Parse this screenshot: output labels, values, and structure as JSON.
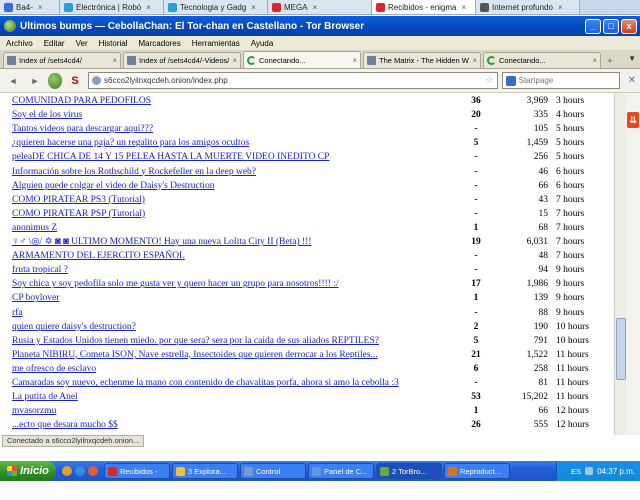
{
  "host_tabs": [
    {
      "label": "Ba4-",
      "color": "#3b6bd6",
      "active": false
    },
    {
      "label": "Electrónica | Robó",
      "color": "#2a9dd6",
      "active": false
    },
    {
      "label": "Tecnologia y Gadg",
      "color": "#2a9dd6",
      "active": false
    },
    {
      "label": "MEGA",
      "color": "#d9272e",
      "active": false
    },
    {
      "label": "Recibidos - enigma",
      "color": "#d9272e",
      "active": true
    },
    {
      "label": "Internet profundo",
      "color": "#555555",
      "active": false
    }
  ],
  "window": {
    "title": "Últimos bumps — CebollaChan: El Tor-chan en Castellano - Tor Browser",
    "minimize": "_",
    "maximize": "□",
    "close": "x"
  },
  "menu": [
    "Archivo",
    "Editar",
    "Ver",
    "Historial",
    "Marcadores",
    "Herramientas",
    "Ayuda"
  ],
  "tabs": [
    {
      "label": "Index of /sets4cd4/",
      "active": false,
      "loading": false
    },
    {
      "label": "Index of /sets4cd4/-Videos/",
      "active": false,
      "loading": false
    },
    {
      "label": "Conectando...",
      "active": true,
      "loading": true
    },
    {
      "label": "The Matrix - The Hidden Wiki",
      "active": false,
      "loading": false
    },
    {
      "label": "Conectando...",
      "active": false,
      "loading": true
    }
  ],
  "nav": {
    "back": "◄",
    "forward": "►",
    "url": "s6cco2lyilnxqcdeh.onion/index.php",
    "search_placeholder": "Startpage"
  },
  "threads": [
    {
      "topic": "COMUNIDAD PARA PEDOFILOS",
      "replies": "36",
      "views": "3,969",
      "age": "3 hours"
    },
    {
      "topic": "Soy el de los virus",
      "replies": "20",
      "views": "335",
      "age": "4 hours"
    },
    {
      "topic": "Tantos videos para descargar aqui???",
      "replies": "-",
      "views": "105",
      "age": "5 hours"
    },
    {
      "topic": "¿quieren hacerse una paja? un regalito para los amigos ocultos",
      "replies": "5",
      "views": "1,459",
      "age": "5 hours"
    },
    {
      "topic": "peleaDE CHICA DE 14 Y 15 PELEA HASTA LA MUERTE VIDEO INEDITO CP",
      "replies": "-",
      "views": "256",
      "age": "5 hours"
    },
    {
      "topic": "Información sobre los Rothschild y Rockefeller en la deep web?",
      "replies": "-",
      "views": "46",
      "age": "6 hours"
    },
    {
      "topic": "Alguien puede colgar el video de Daisy's Destruction",
      "replies": "-",
      "views": "66",
      "age": "6 hours"
    },
    {
      "topic": "COMO PIRATEAR PS3 (Tutorial)",
      "replies": "-",
      "views": "43",
      "age": "7 hours"
    },
    {
      "topic": "COMO PIRATEAR PSP (Tutorial)",
      "replies": "-",
      "views": "15",
      "age": "7 hours"
    },
    {
      "topic": "anonimus Z",
      "replies": "1",
      "views": "68",
      "age": "7 hours"
    },
    {
      "topic": "♀♂ \\◎/ ✡ ◙ ◙ ULTIMO MOMENTO! Hay una nueva Lolita City II (Beta) !!!",
      "replies": "19",
      "views": "6,031",
      "age": "7 hours"
    },
    {
      "topic": "ARMAMENTO DEL EJERCITO ESPAÑOL",
      "replies": "-",
      "views": "48",
      "age": "7 hours"
    },
    {
      "topic": "fruta tropical ?",
      "replies": "-",
      "views": "94",
      "age": "9 hours"
    },
    {
      "topic": "Soy chica y soy pedofila solo me gusta ver y quero hacer un grupo para nosotros!!!! :/",
      "replies": "17",
      "views": "1,986",
      "age": "9 hours"
    },
    {
      "topic": "CP boylover",
      "replies": "1",
      "views": "139",
      "age": "9 hours"
    },
    {
      "topic": "rfa",
      "replies": "-",
      "views": "88",
      "age": "9 hours"
    },
    {
      "topic": "quien quiere daisy's destruction?",
      "replies": "2",
      "views": "190",
      "age": "10 hours"
    },
    {
      "topic": "Rusia y Estados Unidos tienen miedo. por que sera? sera por la caida de sus aliados REPTILES?",
      "replies": "5",
      "views": "791",
      "age": "10 hours"
    },
    {
      "topic": "Planeta NIBIRU, Cometa ISON, Nave estrella, Insectoides que quieren derrocar a los Reptiles...",
      "replies": "21",
      "views": "1,522",
      "age": "11 hours"
    },
    {
      "topic": "me ofresco de esclavo",
      "replies": "6",
      "views": "258",
      "age": "11 hours"
    },
    {
      "topic": "Camaradas soy nuevo, echenme la mano con contenido de chavalitas porfa, ahora si amo la cebolla :3",
      "replies": "-",
      "views": "81",
      "age": "11 hours"
    },
    {
      "topic": "La putita de Anel",
      "replies": "53",
      "views": "15,202",
      "age": "11 hours"
    },
    {
      "topic": "mvasorzmu",
      "replies": "1",
      "views": "66",
      "age": "12 hours"
    },
    {
      "topic": "...ecto que desara mucho $$",
      "replies": "26",
      "views": "555",
      "age": "12 hours"
    }
  ],
  "status": "Conectado a s6cco2lyilnxqcdeh.onion...",
  "taskbar": {
    "start": "Inicio",
    "tasks": [
      {
        "label": "Recibidos -",
        "color": "#d9272e",
        "active": false
      },
      {
        "label": "3 Explora...",
        "color": "#f0c040",
        "active": false
      },
      {
        "label": "Control",
        "color": "#7a9ad0",
        "active": false
      },
      {
        "label": "Panel de C...",
        "color": "#5a9ae0",
        "active": false
      },
      {
        "label": "2 TorBro...",
        "color": "#6aa840",
        "active": true
      },
      {
        "label": "Reproduct...",
        "color": "#e07020",
        "active": false
      }
    ],
    "lang": "ES",
    "clock": "04:37 p.m."
  }
}
